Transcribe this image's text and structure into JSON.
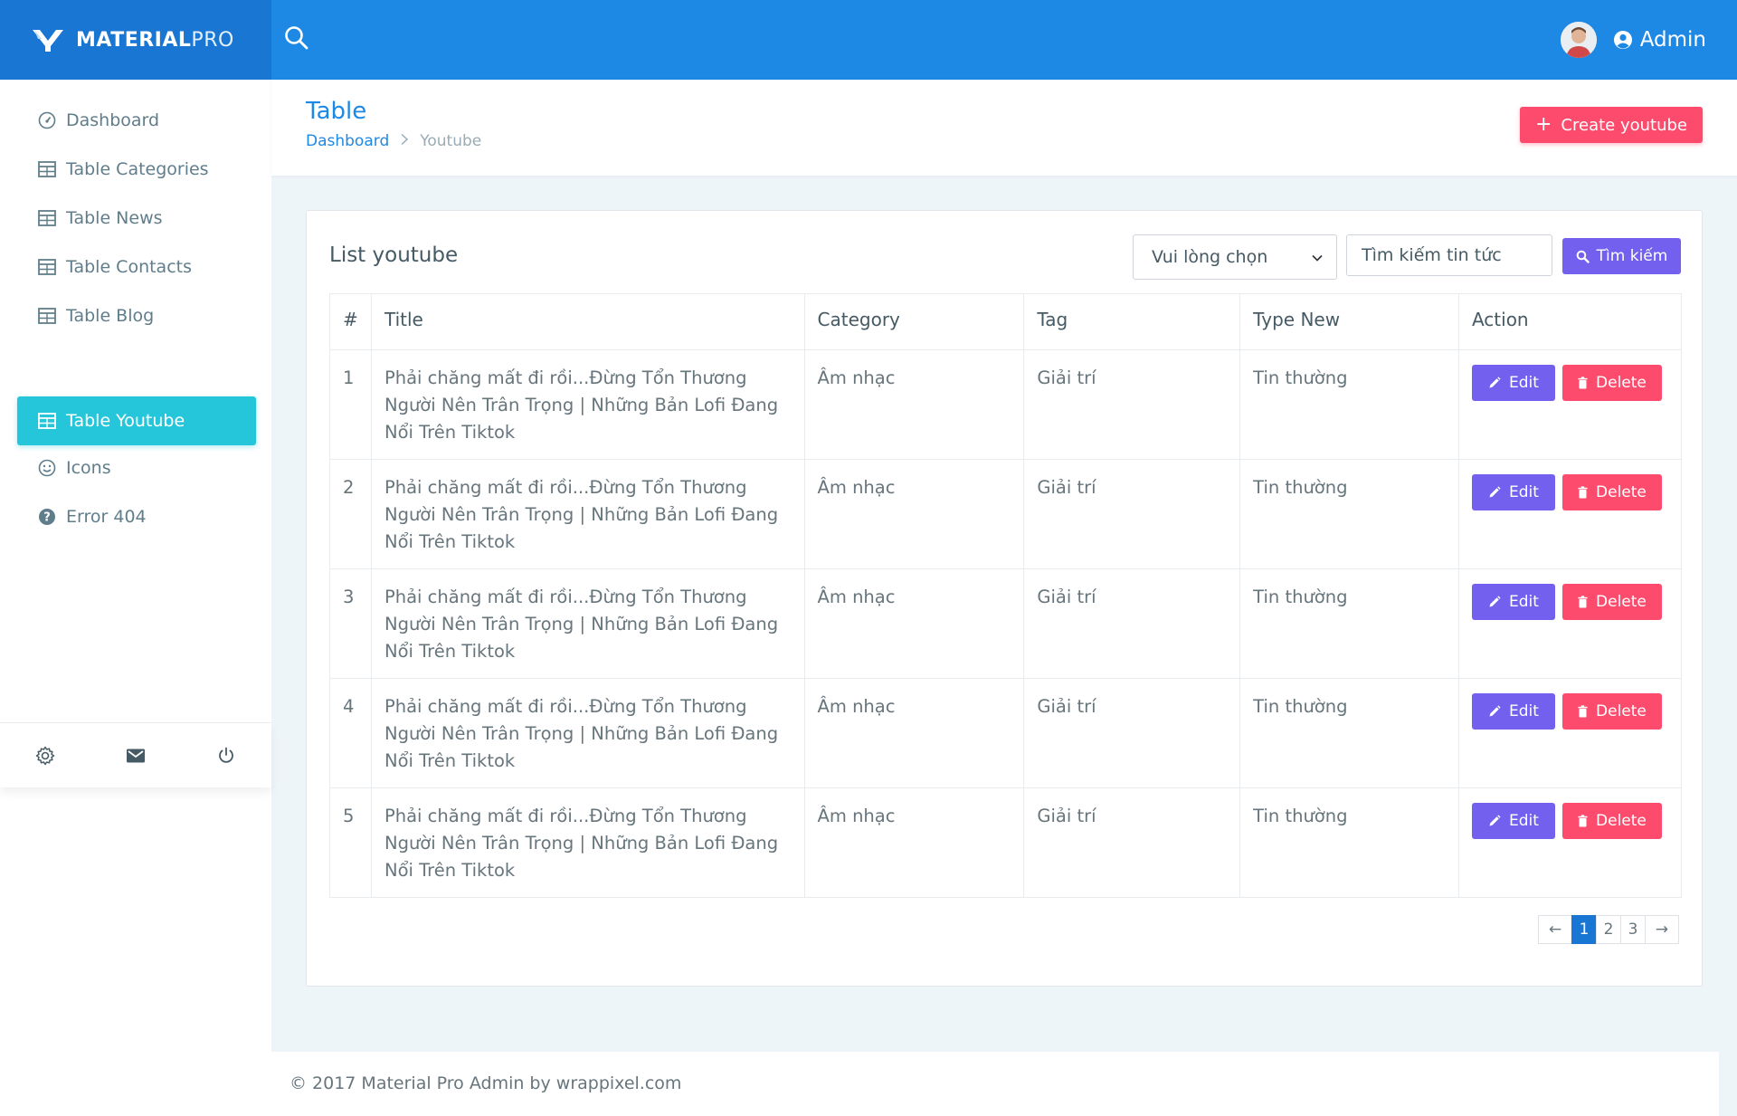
{
  "brand": {
    "name_bold": "MATERIAL",
    "name_light": "PRO"
  },
  "header": {
    "user_label": "Admin"
  },
  "sidebar": {
    "items": [
      {
        "label": "Dashboard",
        "icon": "gauge-icon",
        "active": false
      },
      {
        "label": "Table Categories",
        "icon": "table-icon",
        "active": false
      },
      {
        "label": "Table News",
        "icon": "table-icon",
        "active": false
      },
      {
        "label": "Table Contacts",
        "icon": "table-icon",
        "active": false
      },
      {
        "label": "Table Blog",
        "icon": "table-icon",
        "active": false
      },
      {
        "label": "Table Youtube",
        "icon": "table-icon",
        "active": true
      },
      {
        "label": "Icons",
        "icon": "smile-icon",
        "active": false
      },
      {
        "label": "Error 404",
        "icon": "help-icon",
        "active": false
      }
    ],
    "footer_icons": [
      "gear-icon",
      "mail-icon",
      "power-icon"
    ]
  },
  "page": {
    "title": "Table",
    "breadcrumb": {
      "home": "Dashboard",
      "current": "Youtube"
    },
    "create_label": "Create youtube"
  },
  "card": {
    "title": "List youtube",
    "filter_select": "Vui lòng chọn",
    "search_placeholder": "Tìm kiếm tin tức",
    "search_button": "Tìm kiếm"
  },
  "table": {
    "headers": [
      "#",
      "Title",
      "Category",
      "Tag",
      "Type New",
      "Action"
    ],
    "rows": [
      {
        "num": "1",
        "title": "Phải chăng mất đi rồi...Đừng Tổn Thương Người Nên Trân Trọng | Những Bản Lofi Đang Nổi Trên Tiktok",
        "category": "Âm nhạc",
        "tag": "Giải trí",
        "type": "Tin thường"
      },
      {
        "num": "2",
        "title": "Phải chăng mất đi rồi...Đừng Tổn Thương Người Nên Trân Trọng | Những Bản Lofi Đang Nổi Trên Tiktok",
        "category": "Âm nhạc",
        "tag": "Giải trí",
        "type": "Tin thường"
      },
      {
        "num": "3",
        "title": "Phải chăng mất đi rồi...Đừng Tổn Thương Người Nên Trân Trọng | Những Bản Lofi Đang Nổi Trên Tiktok",
        "category": "Âm nhạc",
        "tag": "Giải trí",
        "type": "Tin thường"
      },
      {
        "num": "4",
        "title": "Phải chăng mất đi rồi...Đừng Tổn Thương Người Nên Trân Trọng | Những Bản Lofi Đang Nổi Trên Tiktok",
        "category": "Âm nhạc",
        "tag": "Giải trí",
        "type": "Tin thường"
      },
      {
        "num": "5",
        "title": "Phải chăng mất đi rồi...Đừng Tổn Thương Người Nên Trân Trọng | Những Bản Lofi Đang Nổi Trên Tiktok",
        "category": "Âm nhạc",
        "tag": "Giải trí",
        "type": "Tin thường"
      }
    ],
    "edit_label": "Edit",
    "delete_label": "Delete"
  },
  "pagination": {
    "pages": [
      "1",
      "2",
      "3"
    ],
    "active": "1",
    "prev": "←",
    "next": "→"
  },
  "footer": {
    "text": "© 2017 Material Pro Admin by wrappixel.com"
  },
  "colors": {
    "header": "#1e88e5",
    "logo_bg": "#1976d2",
    "active_item": "#26c6da",
    "primary_btn": "#7460ee",
    "danger_btn": "#fc4b6c",
    "link": "#1e88e5"
  }
}
